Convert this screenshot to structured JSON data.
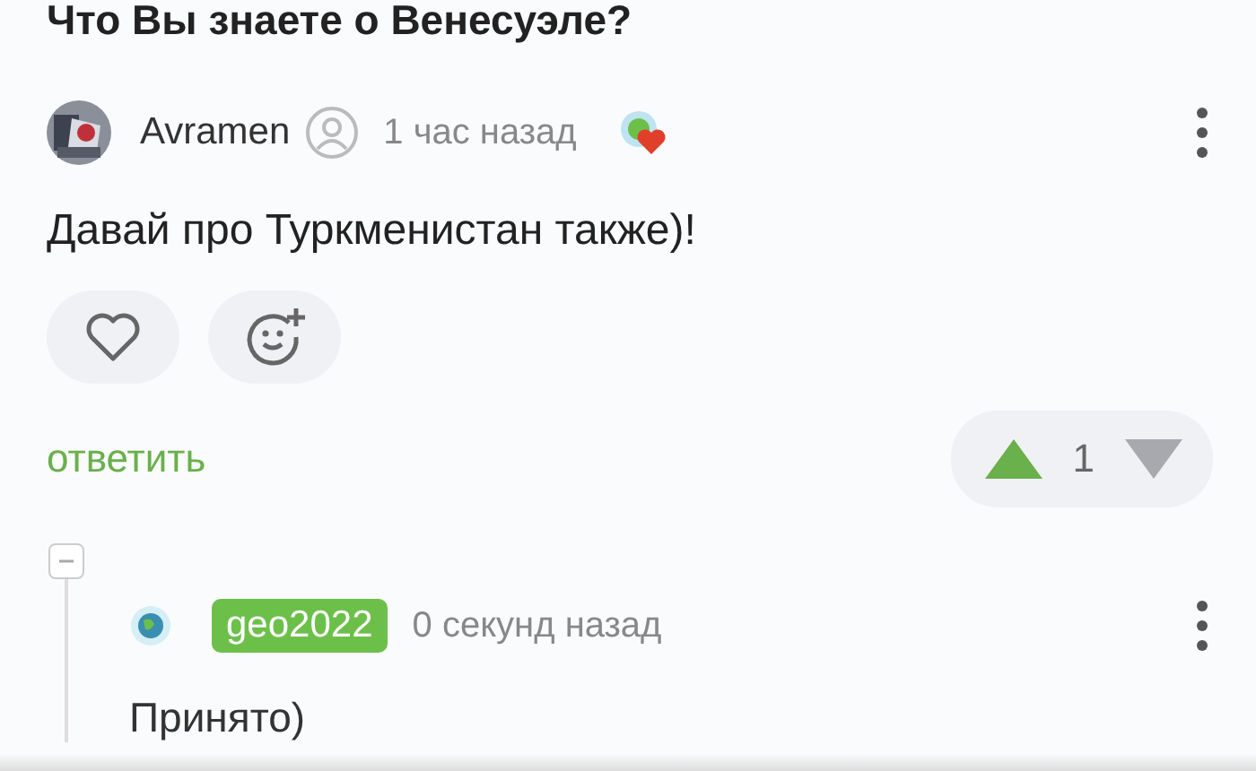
{
  "title": "Что Вы знаете о Венесуэле?",
  "comment": {
    "author": "Avramen",
    "highlighted": false,
    "time": "1 час назад",
    "text": "Давай про Туркменистан также)!",
    "liked": false,
    "reply_label": "ответить",
    "score": "1",
    "upvoted": true,
    "downvoted": false
  },
  "thread": {
    "expanded": true
  },
  "reply": {
    "author": "geo2022",
    "highlighted": true,
    "time": "0 секунд назад",
    "text": "Принято)"
  }
}
